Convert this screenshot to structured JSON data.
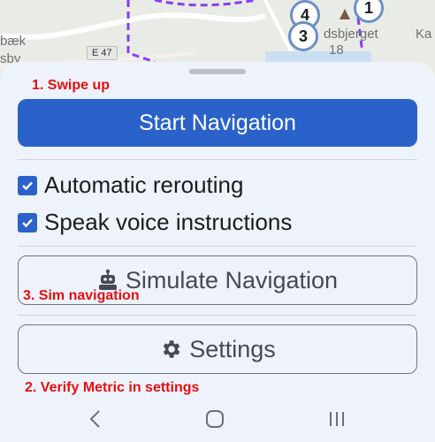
{
  "map": {
    "labels": [
      "bæk",
      "sby",
      "dsbjerget",
      "18",
      "Ka"
    ],
    "road_badge": "E 47",
    "pins": [
      "4",
      "3",
      "1"
    ]
  },
  "annotations": {
    "swipe_up": "1. Swipe up",
    "verify_metric": "2. Verify Metric in settings",
    "sim_navigation": "3. Sim navigation"
  },
  "sheet": {
    "start_navigation": "Start Navigation",
    "automatic_rerouting": "Automatic rerouting",
    "speak_voice_instructions": "Speak voice instructions",
    "simulate_navigation": "Simulate Navigation",
    "settings": "Settings"
  },
  "colors": {
    "primary": "#2a62c9",
    "annotation": "#e40f0f",
    "route": "#8a3cf0"
  },
  "icons": [
    "robot-icon",
    "gear-icon",
    "back-icon",
    "home-icon",
    "recents-icon",
    "checkbox-checked-icon"
  ]
}
